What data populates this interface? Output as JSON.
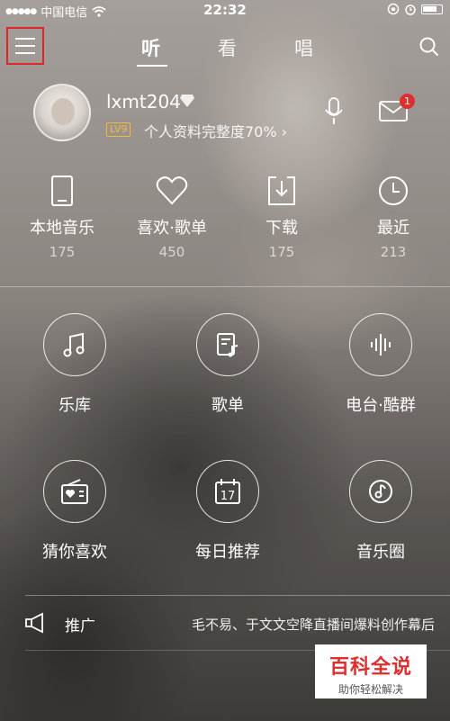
{
  "status_bar": {
    "carrier": "中国电信",
    "time": "22:32"
  },
  "header": {
    "tabs": [
      {
        "label": "听",
        "active": true
      },
      {
        "label": "看",
        "active": false
      },
      {
        "label": "唱",
        "active": false
      }
    ]
  },
  "profile": {
    "username": "lxmt204",
    "level": "LV9",
    "completion_text": "个人资料完整度70%",
    "completion_percent": 70,
    "mail_badge": "1"
  },
  "quick_links": [
    {
      "label": "本地音乐",
      "count": "175",
      "icon": "phone-icon"
    },
    {
      "label": "喜欢·歌单",
      "count": "450",
      "icon": "heart-icon"
    },
    {
      "label": "下载",
      "count": "175",
      "icon": "download-icon"
    },
    {
      "label": "最近",
      "count": "213",
      "icon": "clock-icon"
    }
  ],
  "grid": [
    {
      "label": "乐库",
      "icon": "music-note-icon"
    },
    {
      "label": "歌单",
      "icon": "playlist-icon"
    },
    {
      "label": "电台·酷群",
      "icon": "soundwave-icon"
    },
    {
      "label": "猜你喜欢",
      "icon": "radio-icon"
    },
    {
      "label": "每日推荐",
      "icon": "calendar-icon"
    },
    {
      "label": "音乐圈",
      "icon": "music-circle-icon"
    }
  ],
  "calendar_day": "17",
  "promo": {
    "label": "推广",
    "text": "毛不易、于文文空降直播间爆料创作幕后"
  },
  "watermark": {
    "title": "百科全说",
    "subtitle": "助你轻松解决"
  },
  "colors": {
    "accent_red": "#e02d2d",
    "level_gold": "#f3b73b"
  }
}
